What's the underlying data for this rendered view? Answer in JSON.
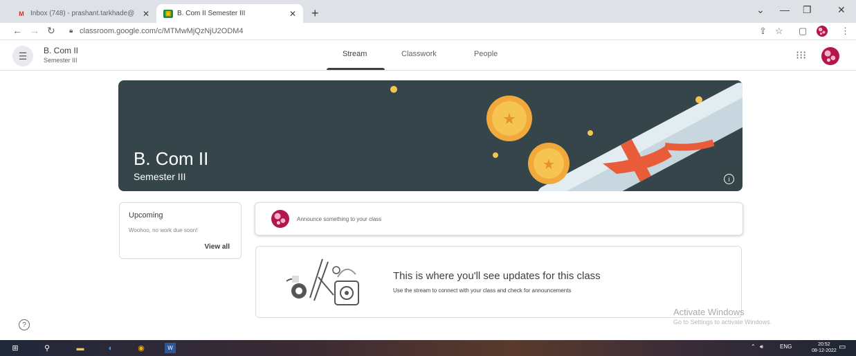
{
  "browser": {
    "tabs": [
      {
        "title": "Inbox (748) - prashant.tarkhade@",
        "icon": "gmail-icon"
      },
      {
        "title": "B. Com II Semester III",
        "icon": "classroom-icon"
      }
    ],
    "new_tab": "+",
    "url": "classroom.google.com/c/MTMwMjQzNjU2ODM4",
    "window_controls": [
      "⌄",
      "—",
      "❐",
      "✕"
    ]
  },
  "header": {
    "class_name": "B. Com II",
    "section": "Semester III",
    "tabs": [
      {
        "label": "Stream",
        "active": true
      },
      {
        "label": "Classwork",
        "active": false
      },
      {
        "label": "People",
        "active": false
      }
    ]
  },
  "banner": {
    "title": "B. Com II",
    "subtitle": "Semester III",
    "background": "#36454a"
  },
  "upcoming": {
    "title": "Upcoming",
    "text": "Woohoo, no work due soon!",
    "link": "View all"
  },
  "announce": {
    "placeholder": "Announce something to your class"
  },
  "empty_state": {
    "title": "This is where you'll see updates for this class",
    "text": "Use the stream to connect with your class and check for announcements"
  },
  "watermark": {
    "line1": "Activate Windows",
    "line2": "Go to Settings to activate Windows."
  },
  "taskbar": {
    "lang": "ENG",
    "time": "20:52",
    "date": "08-12-2022"
  },
  "colors": {
    "accent": "#3c4043",
    "banner": "#36454a",
    "avatar": "#b3164f"
  }
}
